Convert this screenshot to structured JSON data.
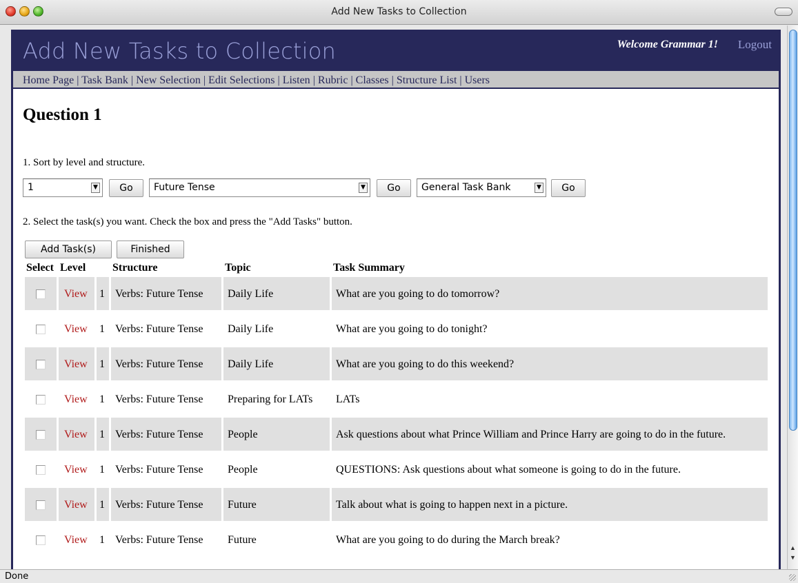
{
  "window": {
    "title": "Add New Tasks to Collection"
  },
  "header": {
    "title": "Add New Tasks to Collection",
    "welcome": "Welcome Grammar 1!",
    "logout": "Logout"
  },
  "nav": {
    "items": [
      "Home Page",
      "Task Bank",
      "New Selection",
      "Edit Selections",
      "Listen",
      "Rubric",
      "Classes",
      "Structure List",
      "Users"
    ],
    "separator": "|"
  },
  "main": {
    "heading": "Question 1",
    "step1": "1. Sort by level and structure.",
    "step2": "2. Select the task(s) you want. Check the box and press the \"Add Tasks\" button.",
    "filters": {
      "level_value": "1",
      "structure_value": "Future Tense",
      "bank_value": "General Task Bank",
      "go_label": "Go"
    },
    "buttons": {
      "add": "Add Task(s)",
      "finished": "Finished"
    },
    "table": {
      "headers": {
        "select": "Select",
        "level": "Level",
        "structure": "Structure",
        "topic": "Topic",
        "summary": "Task Summary"
      },
      "view_label": "View",
      "rows": [
        {
          "level": "1",
          "structure": "Verbs: Future Tense",
          "topic": "Daily Life",
          "summary": "What are you going to do tomorrow?"
        },
        {
          "level": "1",
          "structure": "Verbs: Future Tense",
          "topic": "Daily Life",
          "summary": "What are you going to do tonight?"
        },
        {
          "level": "1",
          "structure": "Verbs: Future Tense",
          "topic": "Daily Life",
          "summary": "What are you going to do this weekend?"
        },
        {
          "level": "1",
          "structure": "Verbs: Future Tense",
          "topic": "Preparing for LATs",
          "summary": "LATs"
        },
        {
          "level": "1",
          "structure": "Verbs: Future Tense",
          "topic": "People",
          "summary": "Ask questions about what Prince William and Prince Harry are going to do in the future."
        },
        {
          "level": "1",
          "structure": "Verbs: Future Tense",
          "topic": "People",
          "summary": "QUESTIONS: Ask questions about what someone is going to do in the future."
        },
        {
          "level": "1",
          "structure": "Verbs: Future Tense",
          "topic": "Future",
          "summary": "Talk about what is going to happen next in a picture."
        },
        {
          "level": "1",
          "structure": "Verbs: Future Tense",
          "topic": "Future",
          "summary": "What are you going to do during the March break?"
        }
      ]
    }
  },
  "status": "Done",
  "colors": {
    "header_bg": "#27285a",
    "header_title": "#9aa0d8",
    "link_red": "#b01a1a",
    "row_shade": "#e0e0e0",
    "nav_bg": "#c6c6c6"
  }
}
